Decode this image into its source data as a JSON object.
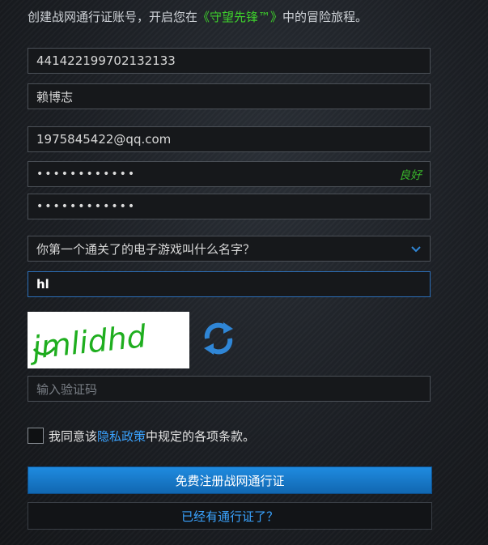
{
  "intro": {
    "prefix": "创建战网通行证账号，开启您在",
    "game": "《守望先锋™》",
    "suffix": "中的冒险旅程。"
  },
  "form": {
    "id_number": "441422199702132133",
    "real_name": "赖博志",
    "email": "1975845422@qq.com",
    "password_mask": "••••••••••••",
    "password_strength": "良好",
    "confirm_password_mask": "••••••••••••",
    "security_question": "你第一个通关了的电子游戏叫什么名字？",
    "security_answer": "hl",
    "captcha_text": "jmlidhd",
    "captcha_placeholder": "输入验证码"
  },
  "agreement": {
    "prefix": "我同意该",
    "link": "隐私政策",
    "suffix": "中规定的各项条款。"
  },
  "buttons": {
    "register": "免费注册战网通行证",
    "have_account": "已经有通行证了？"
  },
  "colors": {
    "accent_blue": "#1f8be0",
    "link_blue": "#3aa3ff",
    "game_green": "#3ed12c",
    "strength_green": "#39b52b"
  },
  "icons": {
    "dropdown": "chevron-down-icon",
    "refresh": "refresh-icon"
  }
}
